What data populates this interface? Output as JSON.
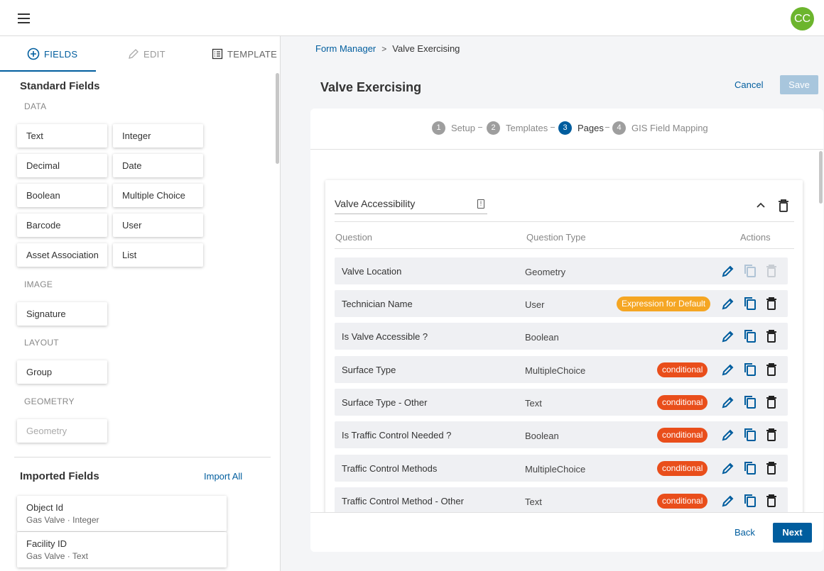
{
  "header": {
    "avatar_initials": "CC"
  },
  "left_panel": {
    "tabs": [
      {
        "label": "FIELDS",
        "icon": "plus-circle-icon",
        "active": true
      },
      {
        "label": "EDIT",
        "icon": "pencil-icon",
        "active": false
      },
      {
        "label": "TEMPLATE",
        "icon": "list-icon",
        "active": false
      }
    ],
    "standard_fields_title": "Standard Fields",
    "categories": {
      "data": "DATA",
      "image": "IMAGE",
      "layout": "LAYOUT",
      "geometry": "GEOMETRY"
    },
    "data_fields": [
      "Text",
      "Integer",
      "Decimal",
      "Date",
      "Boolean",
      "Multiple Choice",
      "Barcode",
      "User",
      "Asset Association",
      "List"
    ],
    "image_fields": [
      "Signature"
    ],
    "layout_fields": [
      "Group"
    ],
    "geometry_fields": [
      "Geometry"
    ],
    "imported_fields_title": "Imported Fields",
    "import_all_label": "Import All",
    "imported_fields": [
      {
        "name": "Object Id",
        "sub": "Gas Valve · Integer"
      },
      {
        "name": "Facility ID",
        "sub": "Gas Valve · Text"
      }
    ]
  },
  "breadcrumb": {
    "parent": "Form Manager",
    "separator": ">",
    "current": "Valve Exercising"
  },
  "page_title": "Valve Exercising",
  "actions": {
    "cancel": "Cancel",
    "save": "Save"
  },
  "stepper": [
    {
      "num": "1",
      "label": "Setup",
      "active": false
    },
    {
      "num": "2",
      "label": "Templates",
      "active": false
    },
    {
      "num": "3",
      "label": "Pages",
      "active": true
    },
    {
      "num": "4",
      "label": "GIS Field Mapping",
      "active": false
    }
  ],
  "page": {
    "name": "Valve Accessibility",
    "columns": {
      "question": "Question",
      "type": "Question Type",
      "actions": "Actions"
    },
    "rows": [
      {
        "question": "Valve Location",
        "type": "Geometry",
        "badge": "",
        "badge_kind": ""
      },
      {
        "question": "Technician Name",
        "type": "User",
        "badge": "Expression for Default",
        "badge_kind": "expr"
      },
      {
        "question": "Is Valve Accessible ?",
        "type": "Boolean",
        "badge": "",
        "badge_kind": ""
      },
      {
        "question": "Surface Type",
        "type": "MultipleChoice",
        "badge": "conditional",
        "badge_kind": "cond"
      },
      {
        "question": "Surface Type - Other",
        "type": "Text",
        "badge": "conditional",
        "badge_kind": "cond"
      },
      {
        "question": "Is Traffic Control Needed ?",
        "type": "Boolean",
        "badge": "conditional",
        "badge_kind": "cond"
      },
      {
        "question": "Traffic Control Methods",
        "type": "MultipleChoice",
        "badge": "conditional",
        "badge_kind": "cond"
      },
      {
        "question": "Traffic Control Method - Other",
        "type": "Text",
        "badge": "conditional",
        "badge_kind": "cond"
      }
    ]
  },
  "footer": {
    "back": "Back",
    "next": "Next"
  },
  "colors": {
    "primary": "#005d9e",
    "avatar": "#6cb52d",
    "expression_badge": "#f5a623",
    "conditional_badge": "#e94e1b"
  }
}
